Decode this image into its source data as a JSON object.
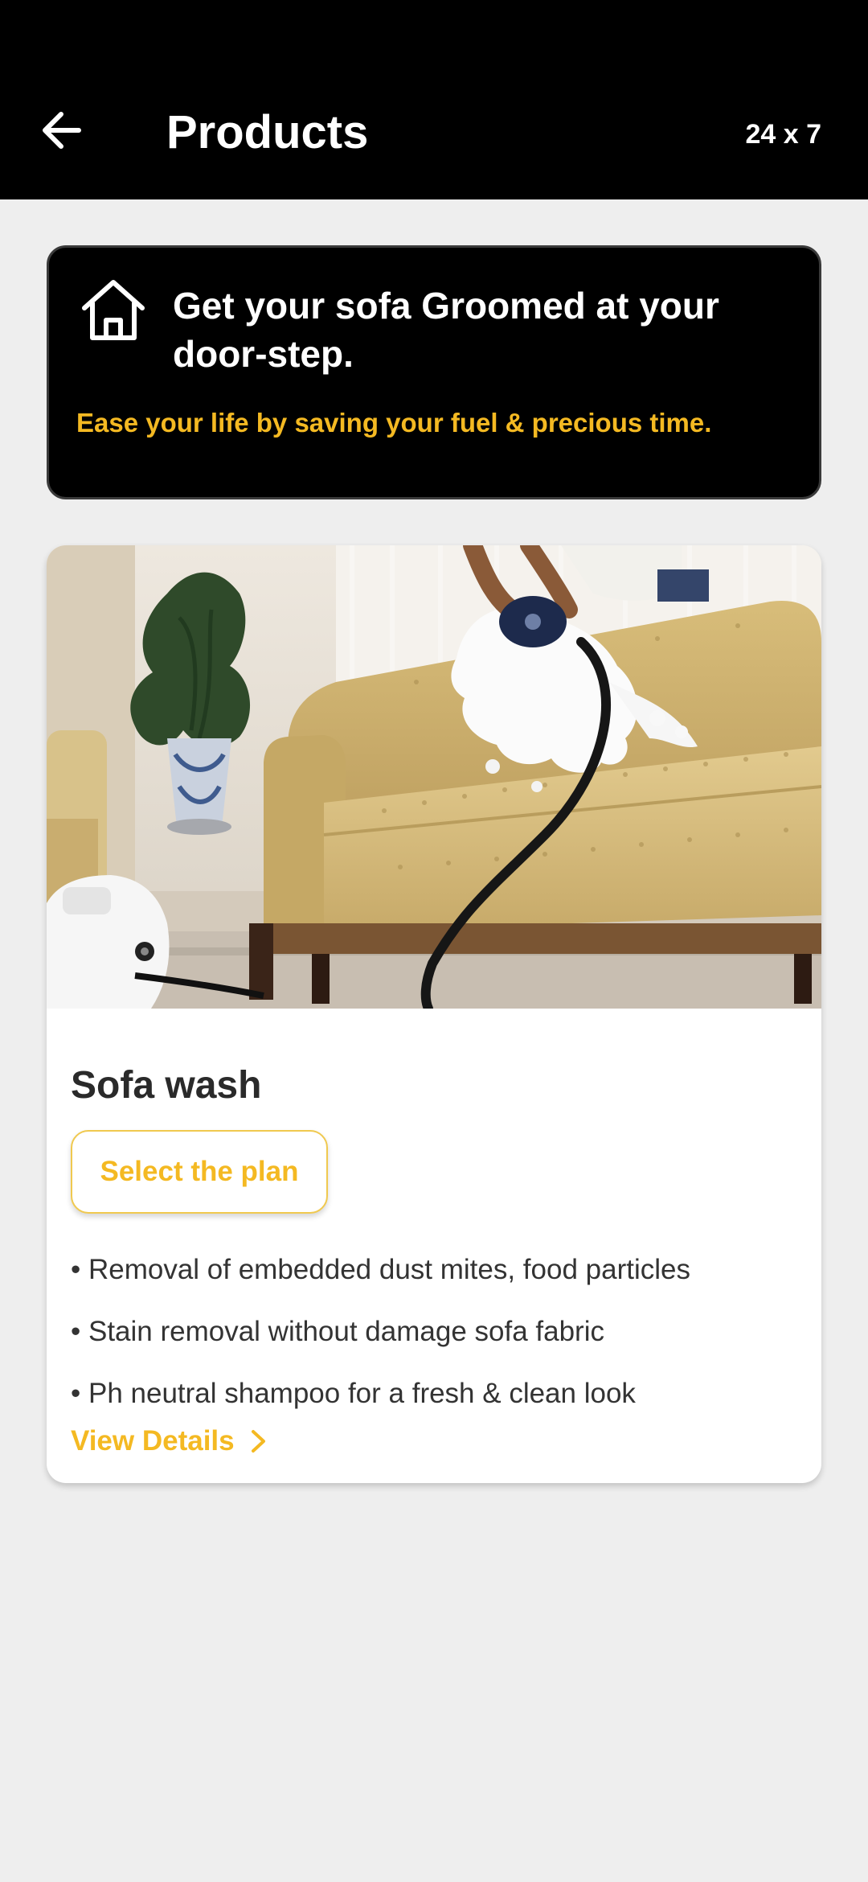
{
  "app_bar": {
    "title": "Products",
    "badge": "24 x 7",
    "back_icon": "arrow-left-icon"
  },
  "promo": {
    "icon": "home-icon",
    "title": "Get your sofa Groomed at your door-step.",
    "subtitle": "Ease your life by saving your fuel & precious time."
  },
  "product": {
    "title": "Sofa wash",
    "select_label": "Select the plan",
    "features": [
      "• Removal of embedded dust mites, food particles",
      "• Stain removal without damage sofa fabric",
      "• Ph neutral shampoo for a fresh & clean look"
    ],
    "details_label": "View Details",
    "details_icon": "chevron-right-icon"
  },
  "colors": {
    "accent": "#f4b922",
    "bar": "#000000",
    "background": "#eeeeee",
    "text": "#2a2a2a"
  }
}
